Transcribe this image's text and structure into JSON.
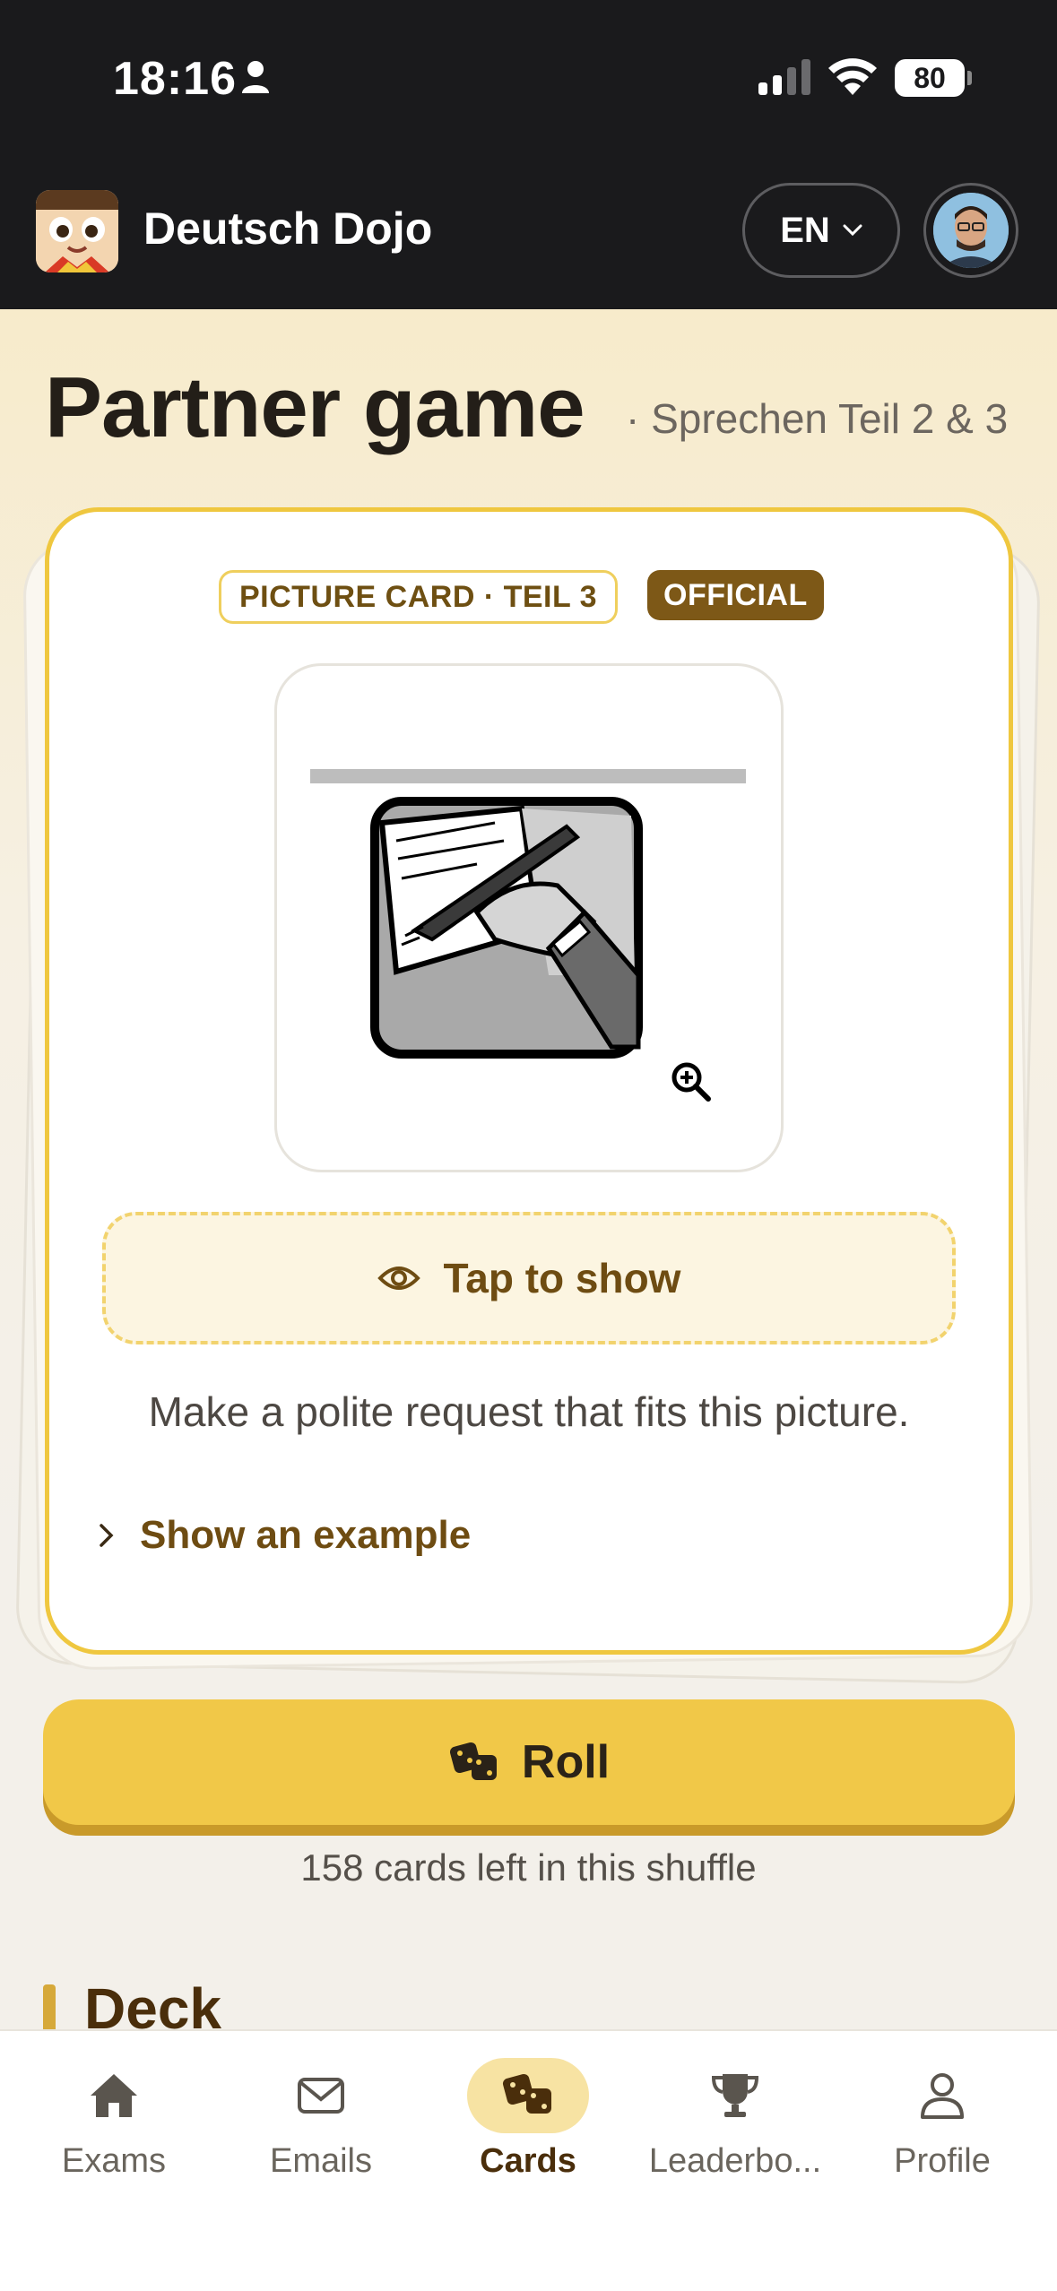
{
  "status_bar": {
    "time": "18:16",
    "battery": "80"
  },
  "header": {
    "app_name": "Deutsch Dojo",
    "language": "EN"
  },
  "page": {
    "title": "Partner game",
    "subtitle": "· Sprechen Teil 2 & 3"
  },
  "card": {
    "type_badge": "PICTURE CARD · TEIL 3",
    "source_badge": "OFFICIAL",
    "reveal_label": "Tap to show",
    "prompt": "Make a polite request that fits this picture.",
    "example_label": "Show an example"
  },
  "actions": {
    "roll_label": "Roll",
    "cards_left": "158 cards left in this shuffle"
  },
  "deck": {
    "title": "Deck"
  },
  "nav": {
    "items": [
      {
        "label": "Exams",
        "icon": "home-icon"
      },
      {
        "label": "Emails",
        "icon": "mail-icon"
      },
      {
        "label": "Cards",
        "icon": "dice-icon",
        "active": true
      },
      {
        "label": "Leaderbo...",
        "icon": "trophy-icon"
      },
      {
        "label": "Profile",
        "icon": "person-icon"
      }
    ]
  },
  "colors": {
    "accent": "#f1c848",
    "brand_brown": "#7d5817",
    "header_bg": "#1a1a1c"
  }
}
